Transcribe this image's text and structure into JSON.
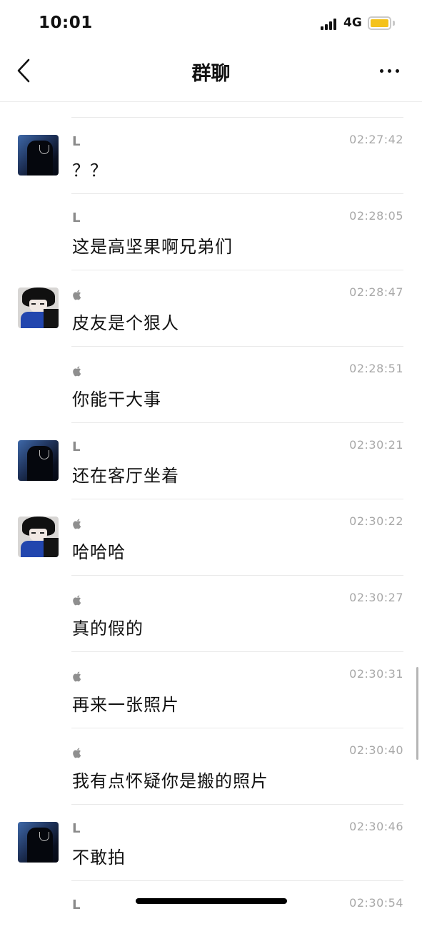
{
  "status_bar": {
    "time": "10:01",
    "network": "4G",
    "battery_color": "#f4c21b"
  },
  "nav": {
    "title": "群聊",
    "back_icon": "chevron-left-icon",
    "more_icon": "more-dots-icon"
  },
  "senders": {
    "L": {
      "label": "L",
      "avatar": "avatar-l"
    },
    "apple": {
      "label": "",
      "icon": "apple-icon",
      "avatar": "avatar-a"
    }
  },
  "messages": [
    {
      "sender": "L",
      "show_avatar": true,
      "time": "02:27:42",
      "text": "？？"
    },
    {
      "sender": "L",
      "show_avatar": false,
      "time": "02:28:05",
      "text": "这是高坚果啊兄弟们"
    },
    {
      "sender": "apple",
      "show_avatar": true,
      "time": "02:28:47",
      "text": "皮友是个狠人"
    },
    {
      "sender": "apple",
      "show_avatar": false,
      "time": "02:28:51",
      "text": "你能干大事"
    },
    {
      "sender": "L",
      "show_avatar": true,
      "time": "02:30:21",
      "text": "还在客厅坐着"
    },
    {
      "sender": "apple",
      "show_avatar": true,
      "time": "02:30:22",
      "text": "哈哈哈"
    },
    {
      "sender": "apple",
      "show_avatar": false,
      "time": "02:30:27",
      "text": "真的假的"
    },
    {
      "sender": "apple",
      "show_avatar": false,
      "time": "02:30:31",
      "text": "再来一张照片"
    },
    {
      "sender": "apple",
      "show_avatar": false,
      "time": "02:30:40",
      "text": "我有点怀疑你是搬的照片"
    },
    {
      "sender": "L",
      "show_avatar": true,
      "time": "02:30:46",
      "text": "不敢拍"
    },
    {
      "sender": "L",
      "show_avatar": false,
      "time": "02:30:54",
      "text": ""
    }
  ]
}
